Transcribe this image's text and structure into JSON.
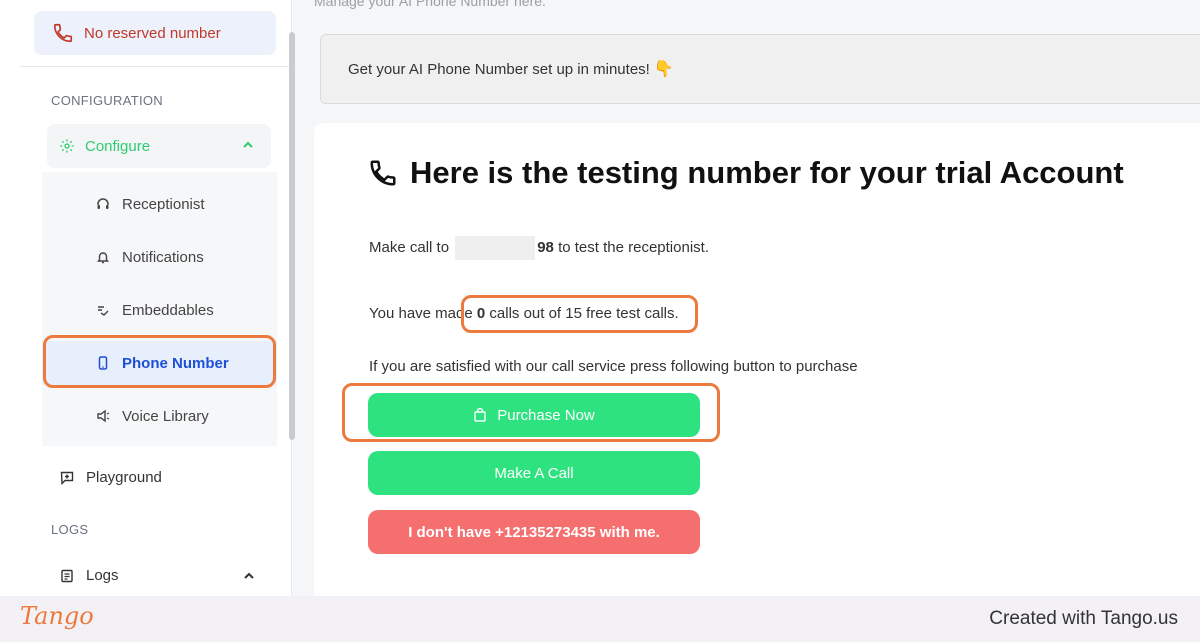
{
  "sidebar": {
    "reserved_label": "No reserved number",
    "config_header": "CONFIGURATION",
    "configure_label": "Configure",
    "sub_items": [
      {
        "label": "Receptionist",
        "icon": "headset-icon"
      },
      {
        "label": "Notifications",
        "icon": "bell-icon"
      },
      {
        "label": "Embeddables",
        "icon": "embed-icon"
      },
      {
        "label": "Phone Number",
        "icon": "mobile-icon",
        "active": true
      },
      {
        "label": "Voice Library",
        "icon": "speaker-icon"
      }
    ],
    "playground_label": "Playground",
    "logs_header": "LOGS",
    "logs_label": "Logs"
  },
  "main": {
    "top_text": "Manage your AI Phone Number here.",
    "banner_text": "Get your AI Phone Number set up in minutes!",
    "banner_emoji": "👇",
    "card_title": "Here is the testing number for your trial Account",
    "call_prefix": "Make call to",
    "call_number_suffix": "98",
    "call_suffix": "to test the receptionist.",
    "calls_prefix": "You have made",
    "calls_count": "0",
    "calls_suffix": "calls out of 15 free test calls.",
    "purchase_prompt": "If you are satisfied with our call service press following button to purchase",
    "purchase_button": "Purchase Now",
    "make_call_button": "Make A Call",
    "no_number_button": "I don't have +12135273435 with me."
  },
  "footer": {
    "logo": "Tango",
    "credit": "Created with Tango.us"
  },
  "colors": {
    "accent_green": "#2ee37f",
    "danger_red": "#f56f6f",
    "highlight_orange": "#ec7a3e",
    "active_blue": "#1e4fd6"
  }
}
